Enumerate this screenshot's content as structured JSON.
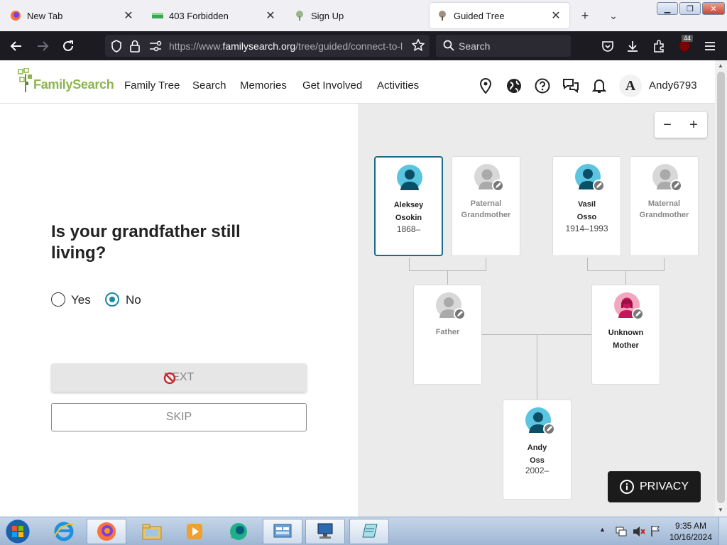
{
  "browser": {
    "tabs": [
      {
        "title": "New Tab",
        "favicon": "firefox-icon"
      },
      {
        "title": "403 Forbidden",
        "favicon": "green-bar-icon"
      },
      {
        "title": "Sign Up",
        "favicon": "tree-icon"
      },
      {
        "title": "Guided Tree",
        "favicon": "tree-icon",
        "active": true
      }
    ],
    "url_prefix": "https://www.",
    "url_domain": "familysearch.org",
    "url_path": "/tree/guided/connect-to-l",
    "search_placeholder": "Search",
    "extension_badge": "44"
  },
  "site": {
    "logo": "FamilySearch",
    "menu": [
      "Family Tree",
      "Search",
      "Memories",
      "Get Involved",
      "Activities"
    ],
    "avatar_letter": "A",
    "username": "Andy6793"
  },
  "question": {
    "text": "Is your grandfather still living?",
    "options": [
      {
        "label": "Yes",
        "checked": false
      },
      {
        "label": "No",
        "checked": true
      }
    ],
    "next_label": "NEXT",
    "skip_label": "SKIP"
  },
  "tree": {
    "zoom_out": "−",
    "zoom_in": "+",
    "persons": {
      "paternal_grandfather": {
        "line1": "Aleksey",
        "line2": "Osokin",
        "dates": "1868–"
      },
      "paternal_grandmother": {
        "line1": "Paternal",
        "line2": "Grandmother"
      },
      "maternal_grandfather": {
        "line1": "Vasil",
        "line2": "Osso",
        "dates": "1914–1993"
      },
      "maternal_grandmother": {
        "line1": "Maternal",
        "line2": "Grandmother"
      },
      "father": {
        "line1": "Father"
      },
      "mother": {
        "line1": "Unknown",
        "line2": "Mother"
      },
      "self": {
        "line1": "Andy",
        "line2": "Oss",
        "dates": "2002–"
      }
    }
  },
  "privacy_label": "PRIVACY",
  "taskbar": {
    "time": "9:35 AM",
    "date": "10/16/2024"
  },
  "colors": {
    "accent_teal": "#1b8aa0",
    "logo_green": "#8cb54b",
    "male_avatar": "#5bc4e0",
    "female_avatar": "#c2185b"
  }
}
